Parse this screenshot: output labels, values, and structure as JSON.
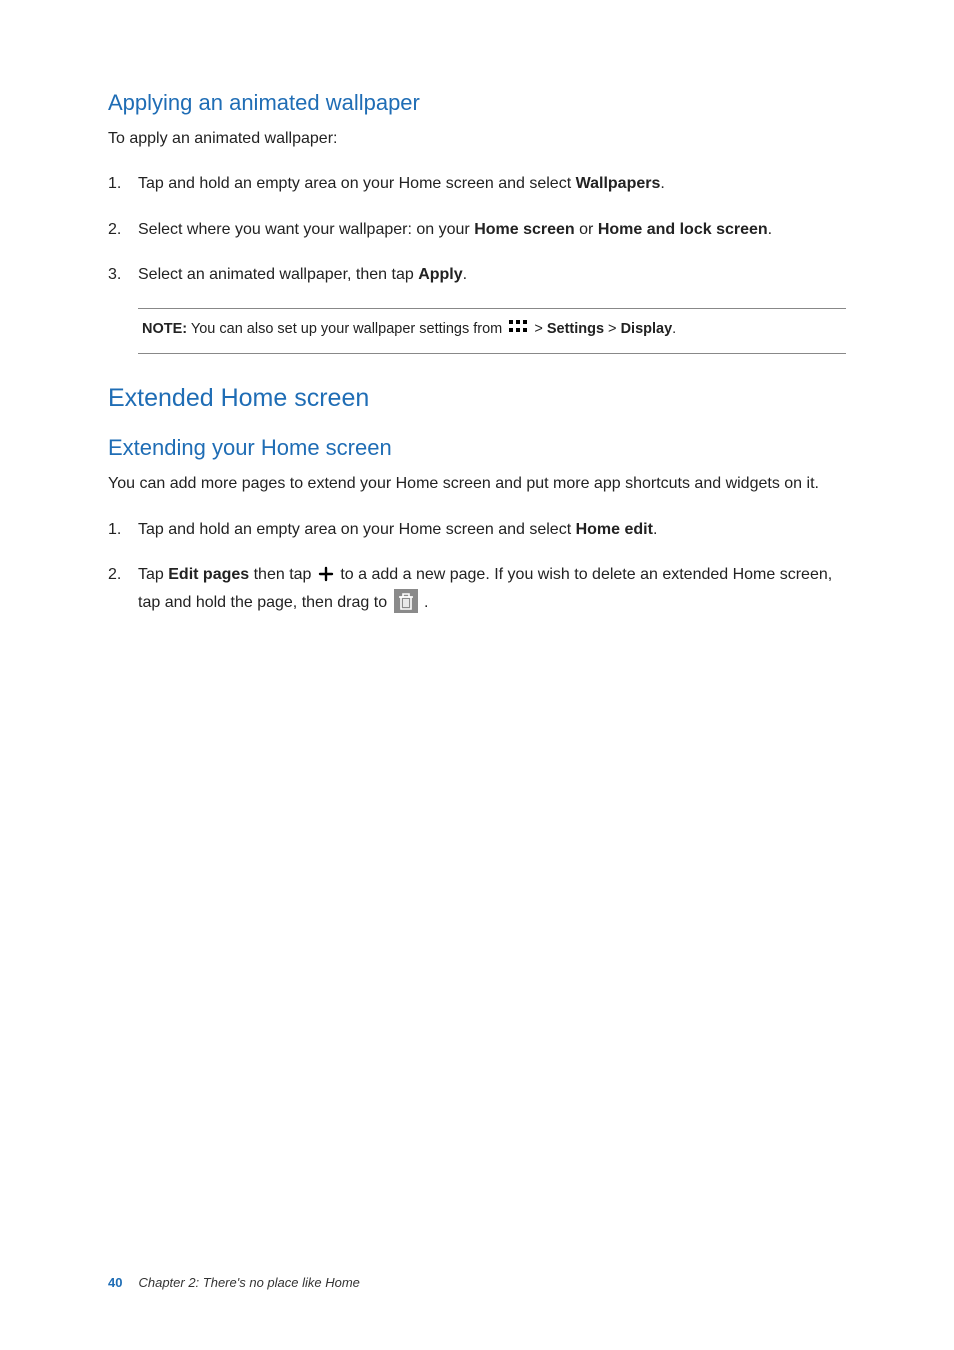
{
  "section1": {
    "heading": "Applying an animated wallpaper",
    "intro": "To apply an animated wallpaper:",
    "steps": {
      "s1_before": "Tap and hold an empty area on your Home screen and select ",
      "s1_bold": "Wallpapers",
      "s1_after": ".",
      "s2_a": "Select where you want your wallpaper: on your ",
      "s2_b1": "Home screen",
      "s2_mid": " or ",
      "s2_b2": "Home and lock screen",
      "s2_after": ".",
      "s3_a": "Select an animated wallpaper, then tap ",
      "s3_b": "Apply",
      "s3_after": "."
    },
    "note": {
      "label": "NOTE:",
      "text_before": " You can also set up your wallpaper settings from ",
      "sep1": " > ",
      "settings": "Settings",
      "sep2": " > ",
      "display": "Display",
      "after": "."
    }
  },
  "section2": {
    "heading": "Extended Home screen",
    "subheading": "Extending your Home screen",
    "intro": "You can add more pages to extend your Home screen and put more app shortcuts and widgets on it.",
    "steps": {
      "s1_before": "Tap and hold an empty area on your Home screen and select ",
      "s1_bold": "Home edit",
      "s1_after": ".",
      "s2_a": "Tap ",
      "s2_b1": "Edit pages",
      "s2_mid1": " then tap ",
      "s2_mid2": " to a add a new page. If you wish to delete an extended Home screen, tap and hold the page, then drag to ",
      "s2_after": " ."
    }
  },
  "footer": {
    "page": "40",
    "chapter": "Chapter 2: There's no place like Home"
  },
  "icons": {
    "apps": "apps-grid-icon",
    "plus": "plus-icon",
    "trash": "trash-icon"
  }
}
